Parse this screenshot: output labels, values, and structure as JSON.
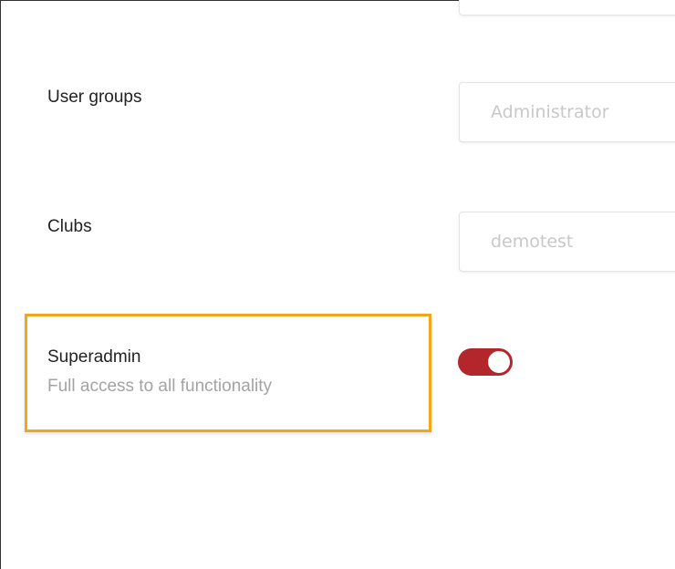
{
  "form": {
    "user_groups": {
      "label": "User groups",
      "placeholder": "Administrator"
    },
    "clubs": {
      "label": "Clubs",
      "placeholder": "demotest"
    },
    "superadmin": {
      "label": "Superadmin",
      "description": "Full access to all functionality",
      "enabled": true
    }
  },
  "colors": {
    "toggle_on": "#b3262b",
    "highlight_border": "#f0a81a"
  }
}
